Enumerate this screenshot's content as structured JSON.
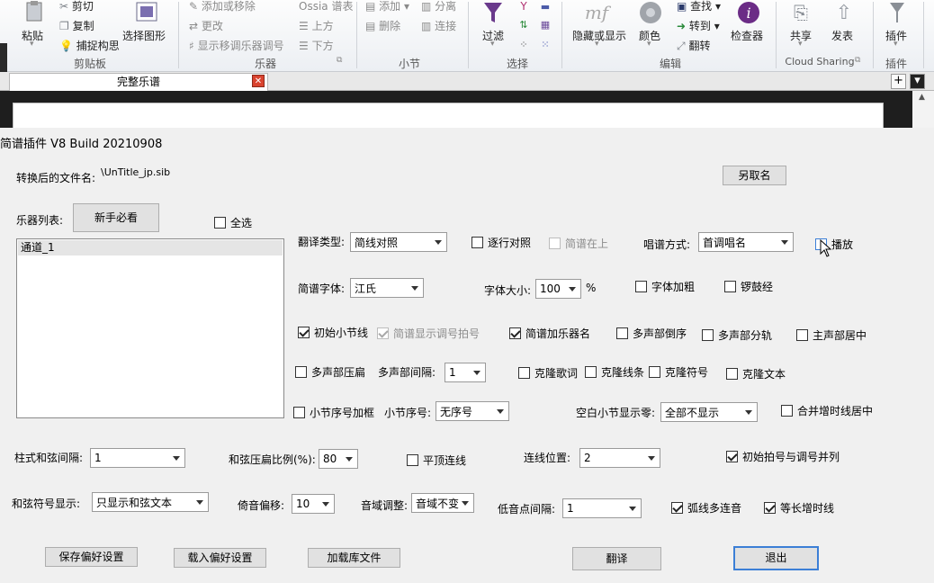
{
  "ribbon": {
    "clipboard": {
      "paste": "粘贴",
      "cut": "剪切",
      "copy": "复制",
      "capture": "捕捉构思",
      "select_graphic": "选择图形",
      "label": "剪贴板"
    },
    "instruments": {
      "add_remove": "添加或移除",
      "change": "更改",
      "show_transposing": "显示移调乐器调号",
      "ossia": "Ossia 谱表",
      "above": "上方",
      "below": "下方",
      "label": "乐器"
    },
    "bars": {
      "add": "添加",
      "delete": "删除",
      "split": "分离",
      "join": "连接",
      "label": "小节"
    },
    "select": {
      "filter": "过滤",
      "label": "选择"
    },
    "edit": {
      "hide_show": "隐藏或显示",
      "color": "颜色",
      "find": "查找",
      "goto": "转到",
      "flip": "翻转",
      "inspector": "检查器",
      "label": "编辑"
    },
    "cloud": {
      "share": "共享",
      "publish": "发表",
      "label": "Cloud Sharing"
    },
    "plugins": {
      "plugin": "插件",
      "label": "插件"
    }
  },
  "document_tab": {
    "title": "完整乐谱",
    "close": "✕",
    "add": "+",
    "menu": "▾"
  },
  "dialog": {
    "title": "简谱插件 V8   Build 20210908",
    "filename_label": "转换后的文件名:",
    "filename_value": "\\UnTitle_jp.sib",
    "rename_button": "另取名",
    "instrument_list_label": "乐器列表:",
    "guide_button": "新手必看",
    "select_all": {
      "label": "全选",
      "checked": false
    },
    "instruments": [
      "通道_1"
    ],
    "translate_type": {
      "label": "翻译类型:",
      "value": "简线对照"
    },
    "line_by_line": {
      "label": "逐行对照",
      "checked": false
    },
    "jianpu_above": {
      "label": "简谱在上",
      "checked": false,
      "disabled": true
    },
    "solfege_mode": {
      "label": "唱谱方式:",
      "value": "首调唱名"
    },
    "playback": {
      "label": "播放",
      "checked": false
    },
    "jianpu_font": {
      "label": "简谱字体:",
      "value": "江氏"
    },
    "font_size": {
      "label": "字体大小:",
      "value": "100",
      "unit": "%"
    },
    "font_bold": {
      "label": "字体加粗",
      "checked": false
    },
    "drum_staff": {
      "label": "锣鼓经",
      "checked": false
    },
    "initial_barline": {
      "label": "初始小节线",
      "checked": true
    },
    "show_key_time": {
      "label": "简谱显示调号拍号",
      "checked": true,
      "disabled": true
    },
    "add_instrument_name": {
      "label": "简谱加乐器名",
      "checked": true
    },
    "multi_reverse": {
      "label": "多声部倒序",
      "checked": false
    },
    "multi_split": {
      "label": "多声部分轨",
      "checked": false
    },
    "main_center": {
      "label": "主声部居中",
      "checked": false
    },
    "multi_compress": {
      "label": "多声部压扁",
      "checked": false
    },
    "multi_spacing": {
      "label": "多声部间隔:",
      "value": "1"
    },
    "clone_lyrics": {
      "label": "克隆歌词",
      "checked": false
    },
    "clone_lines": {
      "label": "克隆线条",
      "checked": false
    },
    "clone_symbols": {
      "label": "克隆符号",
      "checked": false
    },
    "clone_text": {
      "label": "克隆文本",
      "checked": false
    },
    "bar_number_box": {
      "label": "小节序号加框",
      "checked": false
    },
    "bar_number": {
      "label": "小节序号:",
      "value": "无序号"
    },
    "empty_bar_zero": {
      "label": "空白小节显示零:",
      "value": "全部不显示"
    },
    "merge_tie_center": {
      "label": "合并增时线居中",
      "checked": false
    },
    "chord_spacing": {
      "label": "柱式和弦间隔:",
      "value": "1"
    },
    "chord_compress": {
      "label": "和弦压扁比例(%):",
      "value": "80"
    },
    "flat_slur": {
      "label": "平顶连线",
      "checked": false
    },
    "slur_position": {
      "label": "连线位置:",
      "value": "2"
    },
    "initial_meter_key": {
      "label": "初始拍号与调号并列",
      "checked": true
    },
    "chord_symbol": {
      "label": "和弦符号显示:",
      "value": "只显示和弦文本"
    },
    "grace_offset": {
      "label": "倚音偏移:",
      "value": "10"
    },
    "range_adjust": {
      "label": "音域调整:",
      "value": "音域不变"
    },
    "low_dot_spacing": {
      "label": "低音点间隔:",
      "value": "1"
    },
    "arc_multi_tie": {
      "label": "弧线多连音",
      "checked": true
    },
    "equal_tie": {
      "label": "等长增时线",
      "checked": true
    },
    "save_prefs": "保存偏好设置",
    "load_prefs": "载入偏好设置",
    "load_library": "加载库文件",
    "translate_button": "翻译",
    "exit_button": "退出"
  },
  "colors": {
    "default_button_border": "#3c7fd6",
    "close_tab": "#d9432f",
    "inspector_purple": "#6b2c86",
    "filter_purple": "#6a3a8c"
  }
}
